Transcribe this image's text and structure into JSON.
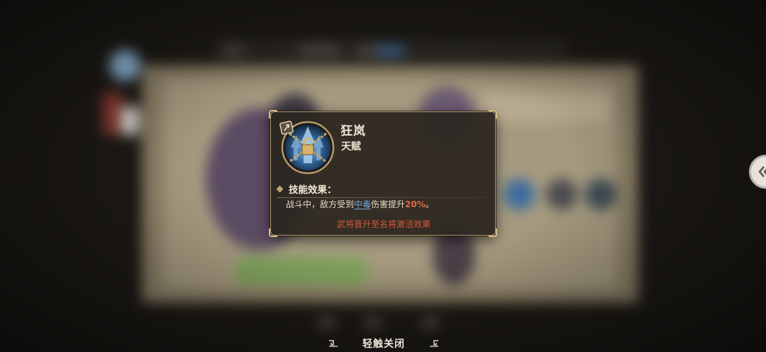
{
  "tooltip": {
    "title": "狂岚",
    "type": "天赋",
    "section_label": "技能效果：",
    "description": {
      "before": "战斗中，敌方受到",
      "keyword": "中毒",
      "middle": "伤害提升",
      "percent": "20%",
      "after": "。"
    },
    "activation_note": "武将晋升至名将激活效果"
  },
  "footer": {
    "close_label": "轻触关闭"
  },
  "icons": {
    "skill": "chained-lock-skill-icon",
    "back": "double-chevron-left-icon"
  },
  "colors": {
    "keyword": "#75a6de",
    "percent": "#e0673f",
    "note": "#d45a37",
    "frame": "#b79a6a"
  }
}
